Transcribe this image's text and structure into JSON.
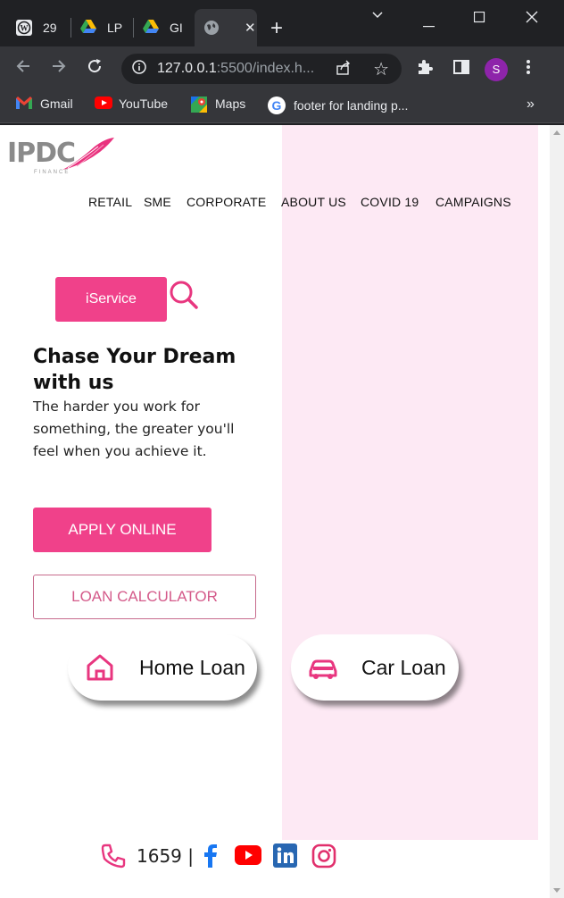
{
  "browser": {
    "tabs": [
      {
        "label": "29",
        "icon": "wordpress-icon"
      },
      {
        "label": "LP",
        "icon": "google-drive-icon"
      },
      {
        "label": "GI",
        "icon": "google-drive-icon"
      },
      {
        "label": "",
        "icon": "globe-icon",
        "active": true
      }
    ],
    "url_host": "127.0.0.1",
    "url_rest": ":5500/index.h...",
    "profile_initial": "S",
    "bookmarks": [
      {
        "label": "Gmail",
        "icon": "gmail-icon"
      },
      {
        "label": "YouTube",
        "icon": "youtube-icon"
      },
      {
        "label": "Maps",
        "icon": "maps-icon"
      },
      {
        "label": "footer for landing p...",
        "icon": "google-icon"
      }
    ],
    "bookmarks_overflow": "»"
  },
  "page": {
    "logo": {
      "text": "IPDC",
      "subtext": "FINANCE"
    },
    "nav": [
      "RETAIL",
      "SME",
      "CORPORATE",
      "ABOUT US",
      "COVID 19",
      "CAMPAIGNS"
    ],
    "iservice_label": "iService",
    "hero": {
      "title": "Chase Your Dream with us",
      "subtitle": "The harder you work for something, the greater you'll feel when you achieve it."
    },
    "apply_label": "APPLY ONLINE",
    "calculator_label": "LOAN CALCULATOR",
    "products": [
      {
        "label": "Home Loan",
        "icon": "home-icon"
      },
      {
        "label": "Car Loan",
        "icon": "car-icon"
      }
    ],
    "footer": {
      "phone": "1659 |"
    }
  },
  "colors": {
    "accent": "#f0418a",
    "panel": "#fde9f4"
  }
}
